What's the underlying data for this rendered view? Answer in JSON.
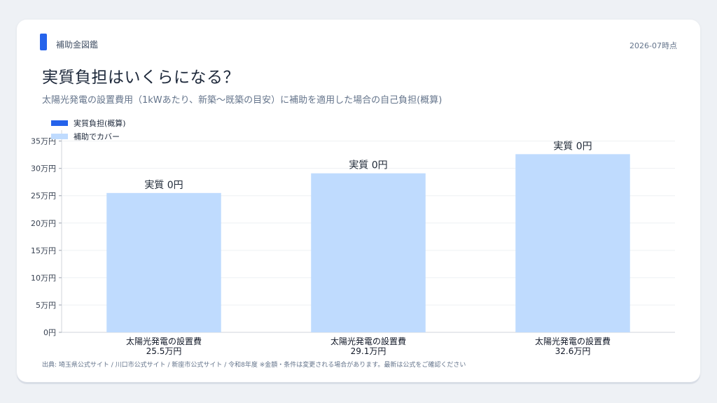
{
  "header": {
    "brand": "補助金図鑑",
    "date": "2026-07時点"
  },
  "title": "実質負担はいくらになる？",
  "subtitle": "太陽光発電の設置費用（1kWあたり、新築〜既築の目安）に補助を適用した場合の自己負担(概算)",
  "source": "出典: 埼玉県公式サイト / 川口市公式サイト / 新座市公式サイト / 令和8年度 ※金額・条件は変更される場合があります。最新は公式をご確認ください",
  "chart_data": {
    "type": "bar",
    "stacked": true,
    "categories": [
      [
        "太陽光発電の設置費",
        "25.5万円"
      ],
      [
        "太陽光発電の設置費",
        "29.1万円"
      ],
      [
        "太陽光発電の設置費",
        "32.6万円"
      ]
    ],
    "series": [
      {
        "name": "実質負担(概算)",
        "values": [
          0,
          0,
          0
        ],
        "color": "#2563eb"
      },
      {
        "name": "補助でカバー",
        "values": [
          25.5,
          29.1,
          32.6
        ],
        "color": "#bfdbfe"
      }
    ],
    "bar_labels": [
      "実質 0円",
      "実質 0円",
      "実質 0円"
    ],
    "y_ticks": [
      {
        "value": 0,
        "label": "0円"
      },
      {
        "value": 5,
        "label": "5万円"
      },
      {
        "value": 10,
        "label": "10万円"
      },
      {
        "value": 15,
        "label": "15万円"
      },
      {
        "value": 20,
        "label": "20万円"
      },
      {
        "value": 25,
        "label": "25万円"
      },
      {
        "value": 30,
        "label": "30万円"
      },
      {
        "value": 35,
        "label": "35万円"
      }
    ],
    "ylim": [
      0,
      37
    ],
    "grid": true,
    "legend_position": "top-left"
  }
}
